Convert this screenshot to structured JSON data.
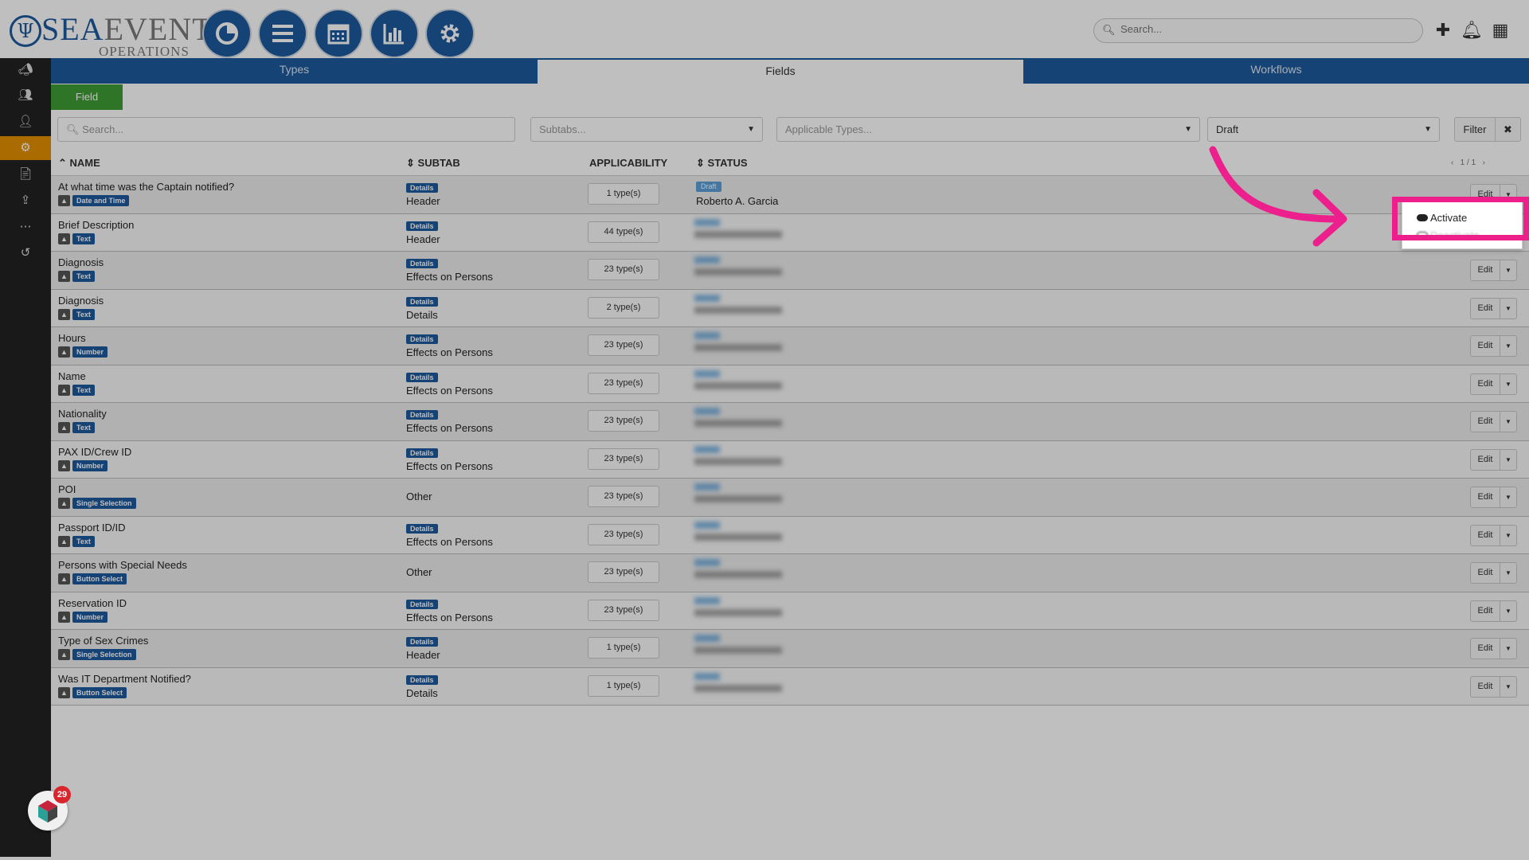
{
  "app": {
    "brand_main": "SEA",
    "brand_second": "EVENT",
    "brand_sub": "OPERATIONS",
    "nav_icons": [
      "dashboard-icon",
      "list-icon",
      "calendar-icon",
      "reports-icon",
      "settings-icon"
    ]
  },
  "header": {
    "search_placeholder": "Search...",
    "icons": [
      "add-icon",
      "bell-icon",
      "grid-icon"
    ]
  },
  "sidebar": {
    "items": [
      "megaphone-icon",
      "users-icon",
      "person-icon",
      "cogs-icon",
      "document-icon",
      "upload-icon",
      "more-icon",
      "history-icon"
    ],
    "active_index": 3,
    "notification_count": "29"
  },
  "tabs": [
    "Types",
    "Fields",
    "Workflows"
  ],
  "active_tab": "Fields",
  "field_button": "Field",
  "filters": {
    "search_placeholder": "Search...",
    "subtabs_placeholder": "Subtabs...",
    "types_placeholder": "Applicable Types...",
    "status_value": "Draft",
    "filter_label": "Filter",
    "clear_label": "✖"
  },
  "columns": [
    "NAME",
    "SUBTAB",
    "APPLICABILITY",
    "STATUS"
  ],
  "sort_markers": {
    "name": "⌃",
    "subtab": "⇕",
    "status": "⇕"
  },
  "pager": "1 / 1",
  "rows": [
    {
      "name": "At what time was the Captain notified?",
      "type": "Date and Time",
      "subtab_tag": "Details",
      "subtab": "Header",
      "applicability": "1 type(s)",
      "status": "Draft",
      "owner": "Roberto A. Garcia",
      "edit": "Edit"
    },
    {
      "name": "Brief Description",
      "type": "Text",
      "subtab_tag": "Details",
      "subtab": "Header",
      "applicability": "44 type(s)",
      "edit": "Edit"
    },
    {
      "name": "Diagnosis",
      "type": "Text",
      "subtab_tag": "Details",
      "subtab": "Effects on Persons",
      "applicability": "23 type(s)",
      "edit": "Edit"
    },
    {
      "name": "Diagnosis",
      "type": "Text",
      "subtab_tag": "Details",
      "subtab": "Details",
      "applicability": "2 type(s)",
      "edit": "Edit"
    },
    {
      "name": "Hours",
      "type": "Number",
      "subtab_tag": "Details",
      "subtab": "Effects on Persons",
      "applicability": "23 type(s)",
      "edit": "Edit"
    },
    {
      "name": "Name",
      "type": "Text",
      "subtab_tag": "Details",
      "subtab": "Effects on Persons",
      "applicability": "23 type(s)",
      "edit": "Edit"
    },
    {
      "name": "Nationality",
      "type": "Text",
      "subtab_tag": "Details",
      "subtab": "Effects on Persons",
      "applicability": "23 type(s)",
      "edit": "Edit"
    },
    {
      "name": "PAX ID/Crew ID",
      "type": "Number",
      "subtab_tag": "Details",
      "subtab": "Effects on Persons",
      "applicability": "23 type(s)",
      "edit": "Edit"
    },
    {
      "name": "POI",
      "type": "Single Selection",
      "subtab_tag": "",
      "subtab": "Other",
      "applicability": "23 type(s)",
      "edit": "Edit"
    },
    {
      "name": "Passport ID/ID",
      "type": "Text",
      "subtab_tag": "Details",
      "subtab": "Effects on Persons",
      "applicability": "23 type(s)",
      "edit": "Edit"
    },
    {
      "name": "Persons with Special Needs",
      "type": "Button Select",
      "subtab_tag": "",
      "subtab": "Other",
      "applicability": "23 type(s)",
      "edit": "Edit"
    },
    {
      "name": "Reservation ID",
      "type": "Number",
      "subtab_tag": "Details",
      "subtab": "Effects on Persons",
      "applicability": "23 type(s)",
      "edit": "Edit"
    },
    {
      "name": "Type of Sex Crimes",
      "type": "Single Selection",
      "subtab_tag": "Details",
      "subtab": "Header",
      "applicability": "1 type(s)",
      "edit": "Edit"
    },
    {
      "name": "Was IT Department Notified?",
      "type": "Button Select",
      "subtab_tag": "Details",
      "subtab": "Details",
      "applicability": "1 type(s)",
      "edit": "Edit"
    }
  ],
  "dropdown": {
    "items": [
      "Activate",
      "Deactivate"
    ]
  },
  "colors": {
    "primary": "#1e5a9c",
    "accent": "#e39100",
    "success": "#3f9c35",
    "highlight": "#ec1f8c",
    "draft": "#5ba0d9"
  }
}
